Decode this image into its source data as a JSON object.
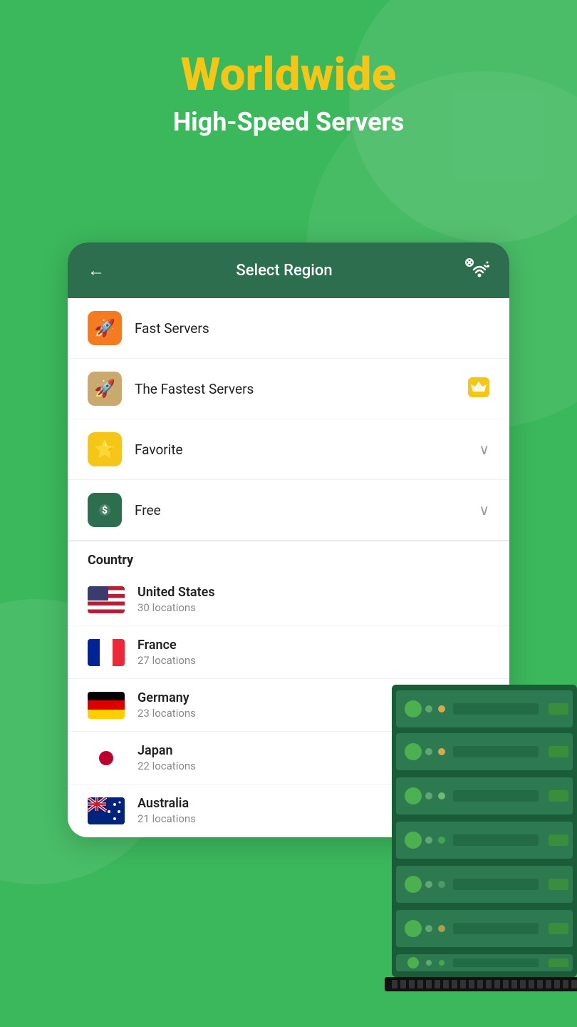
{
  "hero": {
    "title": "Worldwide",
    "subtitle": "High-Speed Servers"
  },
  "header": {
    "back_icon": "←",
    "title": "Select Region",
    "wifi_icon": "⊘"
  },
  "menu_items": [
    {
      "id": "fast-servers",
      "icon": "🚀",
      "icon_class": "icon-orange",
      "label": "Fast Servers",
      "right": ""
    },
    {
      "id": "fastest-servers",
      "icon": "🚀",
      "icon_class": "icon-tan",
      "label": "The Fastest Servers",
      "right": "crown"
    },
    {
      "id": "favorite",
      "icon": "⭐",
      "icon_class": "icon-yellow",
      "label": "Favorite",
      "right": "chevron"
    },
    {
      "id": "free",
      "icon": "$",
      "icon_class": "icon-green-dark",
      "label": "Free",
      "right": "chevron"
    }
  ],
  "section_label": "Country",
  "countries": [
    {
      "id": "us",
      "name": "United States",
      "locations": "30 locations",
      "flag_type": "us"
    },
    {
      "id": "fr",
      "name": "France",
      "locations": "27 locations",
      "flag_type": "fr"
    },
    {
      "id": "de",
      "name": "Germany",
      "locations": "23 locations",
      "flag_type": "de"
    },
    {
      "id": "jp",
      "name": "Japan",
      "locations": "22 locations",
      "flag_type": "jp"
    },
    {
      "id": "au",
      "name": "Australia",
      "locations": "21 locations",
      "flag_type": "au"
    }
  ]
}
